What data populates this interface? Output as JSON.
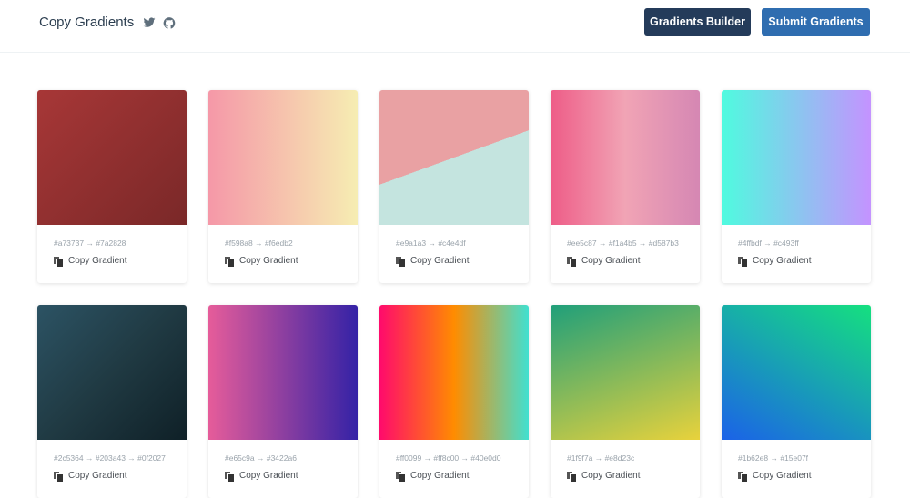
{
  "header": {
    "title": "Copy Gradients",
    "builder_label": "Gradients Builder",
    "submit_label": "Submit Gradients"
  },
  "cards": [
    {
      "codes": "#a73737 → #7a2828",
      "copy": "Copy Gradient",
      "css": "linear-gradient(135deg,#a73737,#7a2828)"
    },
    {
      "codes": "#f598a8 → #f6edb2",
      "copy": "Copy Gradient",
      "css": "linear-gradient(90deg,#f598a8,#f6edb2)"
    },
    {
      "codes": "#e9a1a3 → #c4e4df",
      "copy": "Copy Gradient",
      "css": "linear-gradient(160deg,#e9a1a3 50%,#c4e4df 50%)"
    },
    {
      "codes": "#ee5c87 → #f1a4b5 → #d587b3",
      "copy": "Copy Gradient",
      "css": "linear-gradient(90deg,#ee5c87,#f1a4b5,#d587b3)"
    },
    {
      "codes": "#4ffbdf → #c493ff",
      "copy": "Copy Gradient",
      "css": "linear-gradient(90deg,#4ffbdf,#c493ff)"
    },
    {
      "codes": "#2c5364 → #203a43 → #0f2027",
      "copy": "Copy Gradient",
      "css": "linear-gradient(135deg,#2c5364,#203a43,#0f2027)"
    },
    {
      "codes": "#e65c9a → #3422a6",
      "copy": "Copy Gradient",
      "css": "linear-gradient(90deg,#e65c9a,#3422a6)"
    },
    {
      "codes": "#ff0099 → #ff8c00 → #40e0d0",
      "copy": "Copy Gradient",
      "css": "linear-gradient(90deg,#ff0a6c,#ff8c00,#40e0d0)"
    },
    {
      "codes": "#1f9f7a → #e8d23c",
      "copy": "Copy Gradient",
      "css": "linear-gradient(160deg,#1f9f7a,#e8d23c)"
    },
    {
      "codes": "#1b62e8 → #15e07f",
      "copy": "Copy Gradient",
      "css": "linear-gradient(30deg,#1b62e8,#15e07f)"
    }
  ]
}
